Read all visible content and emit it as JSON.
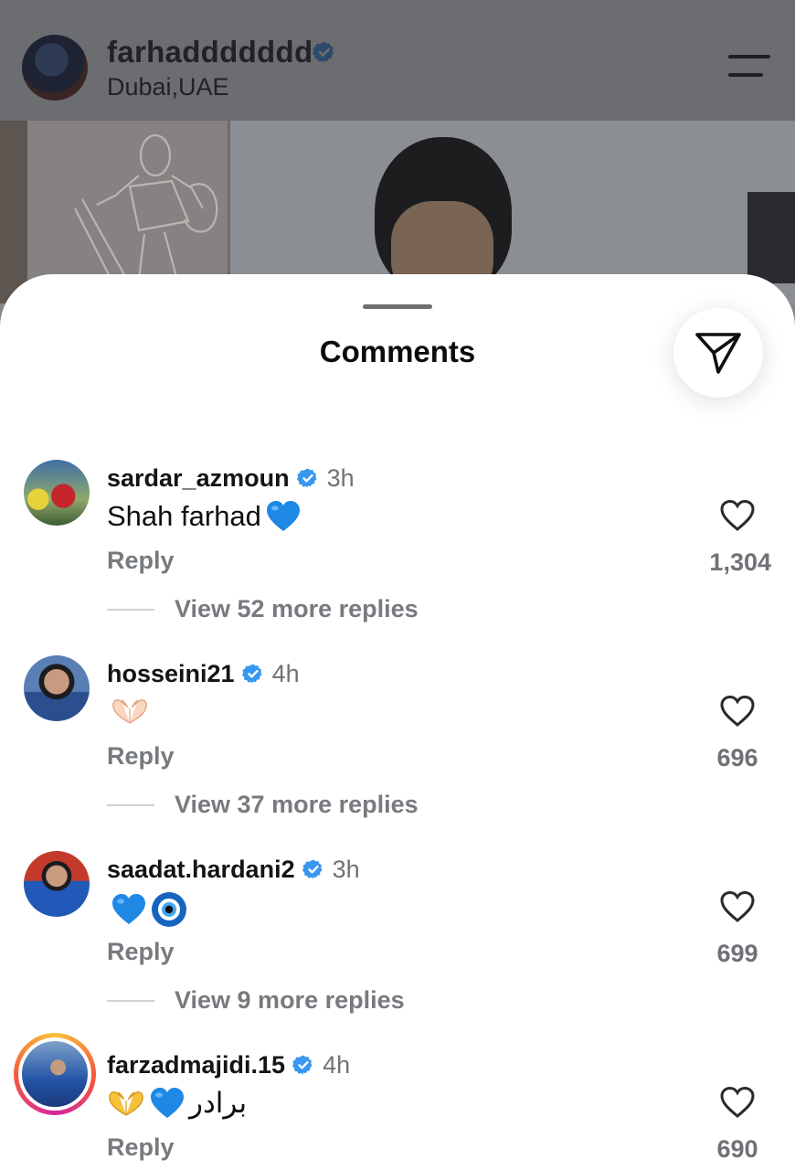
{
  "post": {
    "username": "farhaddddddd",
    "location": "Dubai,UAE"
  },
  "sheet": {
    "title": "Comments"
  },
  "comments": [
    {
      "username": "sardar_azmoun",
      "time": "3h",
      "text": "Shah farhad",
      "emojis": [
        "blue-heart"
      ],
      "reply_label": "Reply",
      "replies_label": "View 52 more replies",
      "likes": "1,304"
    },
    {
      "username": "hosseini21",
      "time": "4h",
      "text": "",
      "emojis": [
        "heart-hands"
      ],
      "reply_label": "Reply",
      "replies_label": "View 37 more replies",
      "likes": "696"
    },
    {
      "username": "saadat.hardani2",
      "time": "3h",
      "text": "",
      "emojis": [
        "blue-heart",
        "nazar-amulet"
      ],
      "reply_label": "Reply",
      "replies_label": "View 9 more replies",
      "likes": "699"
    },
    {
      "username": "farzadmajidi.15",
      "time": "4h",
      "text": "برادر",
      "emojis": [
        "heart-hands",
        "blue-heart"
      ],
      "reply_label": "Reply",
      "replies_label": "",
      "likes": "690"
    }
  ],
  "colors": {
    "verified": "#3897f0",
    "blue_heart": "#1e88e5",
    "story_ring": "#d6249f"
  }
}
